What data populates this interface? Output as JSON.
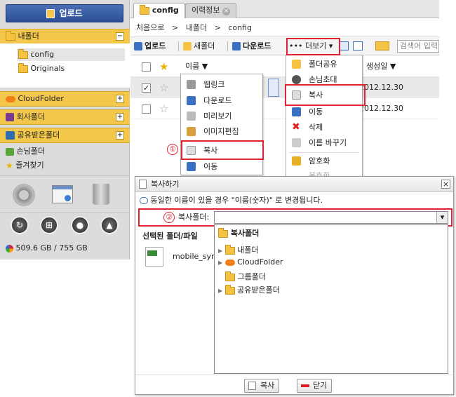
{
  "left": {
    "upload_label": "업로드",
    "my_folder": "내폴더",
    "tree": [
      "config",
      "Originals"
    ],
    "cloud_folder": "CloudFolder",
    "company_folder": "회사폴더",
    "shared_folder": "공유받은폴더",
    "guest_folder": "손님폴더",
    "favorites": "즐겨찾기",
    "storage": "509.6 GB / 755 GB",
    "toggle_minus": "−",
    "toggle_plus": "+"
  },
  "tabs": [
    "config",
    "이력정보"
  ],
  "tab_close": "×",
  "breadcrumb": [
    "처음으로",
    "내폴더",
    "config"
  ],
  "breadcrumb_sep": ">",
  "toolbar": {
    "upload": "업로드",
    "new_folder": "새폴더",
    "download": "다운로드",
    "more": "••• 더보기 ▾",
    "search_placeholder": "검색어 입력"
  },
  "list": {
    "col_name": "이름",
    "col_date_partial": "생성일",
    "sort_arrow": "▼",
    "dates": [
      "2012.12.30",
      "2012.12.30"
    ]
  },
  "context_menu": [
    "웹링크",
    "다운로드",
    "미리보기",
    "이미지편집",
    "복사",
    "이동"
  ],
  "more_menu": [
    "폴더공유",
    "손님초대",
    "복사",
    "이동",
    "삭제",
    "이름 바꾸기",
    "암호화",
    "복호화"
  ],
  "callouts": [
    "①",
    "②"
  ],
  "dialog": {
    "title": "복사하기",
    "notice": "동일한 이름이 있을 경우 \"이름(숫자)\" 로 변경됩니다.",
    "target_label": "복사폴더:",
    "selected_label": "선택된 폴더/파일",
    "file_name": "mobile_sync",
    "tree_root": "복사폴더",
    "tree_items": [
      "내폴더",
      "CloudFolder",
      "그룹폴더",
      "공유받은폴더"
    ],
    "btn_copy": "복사",
    "btn_close": "닫기",
    "close_x": "×",
    "dropdown_arrow": "▾"
  }
}
